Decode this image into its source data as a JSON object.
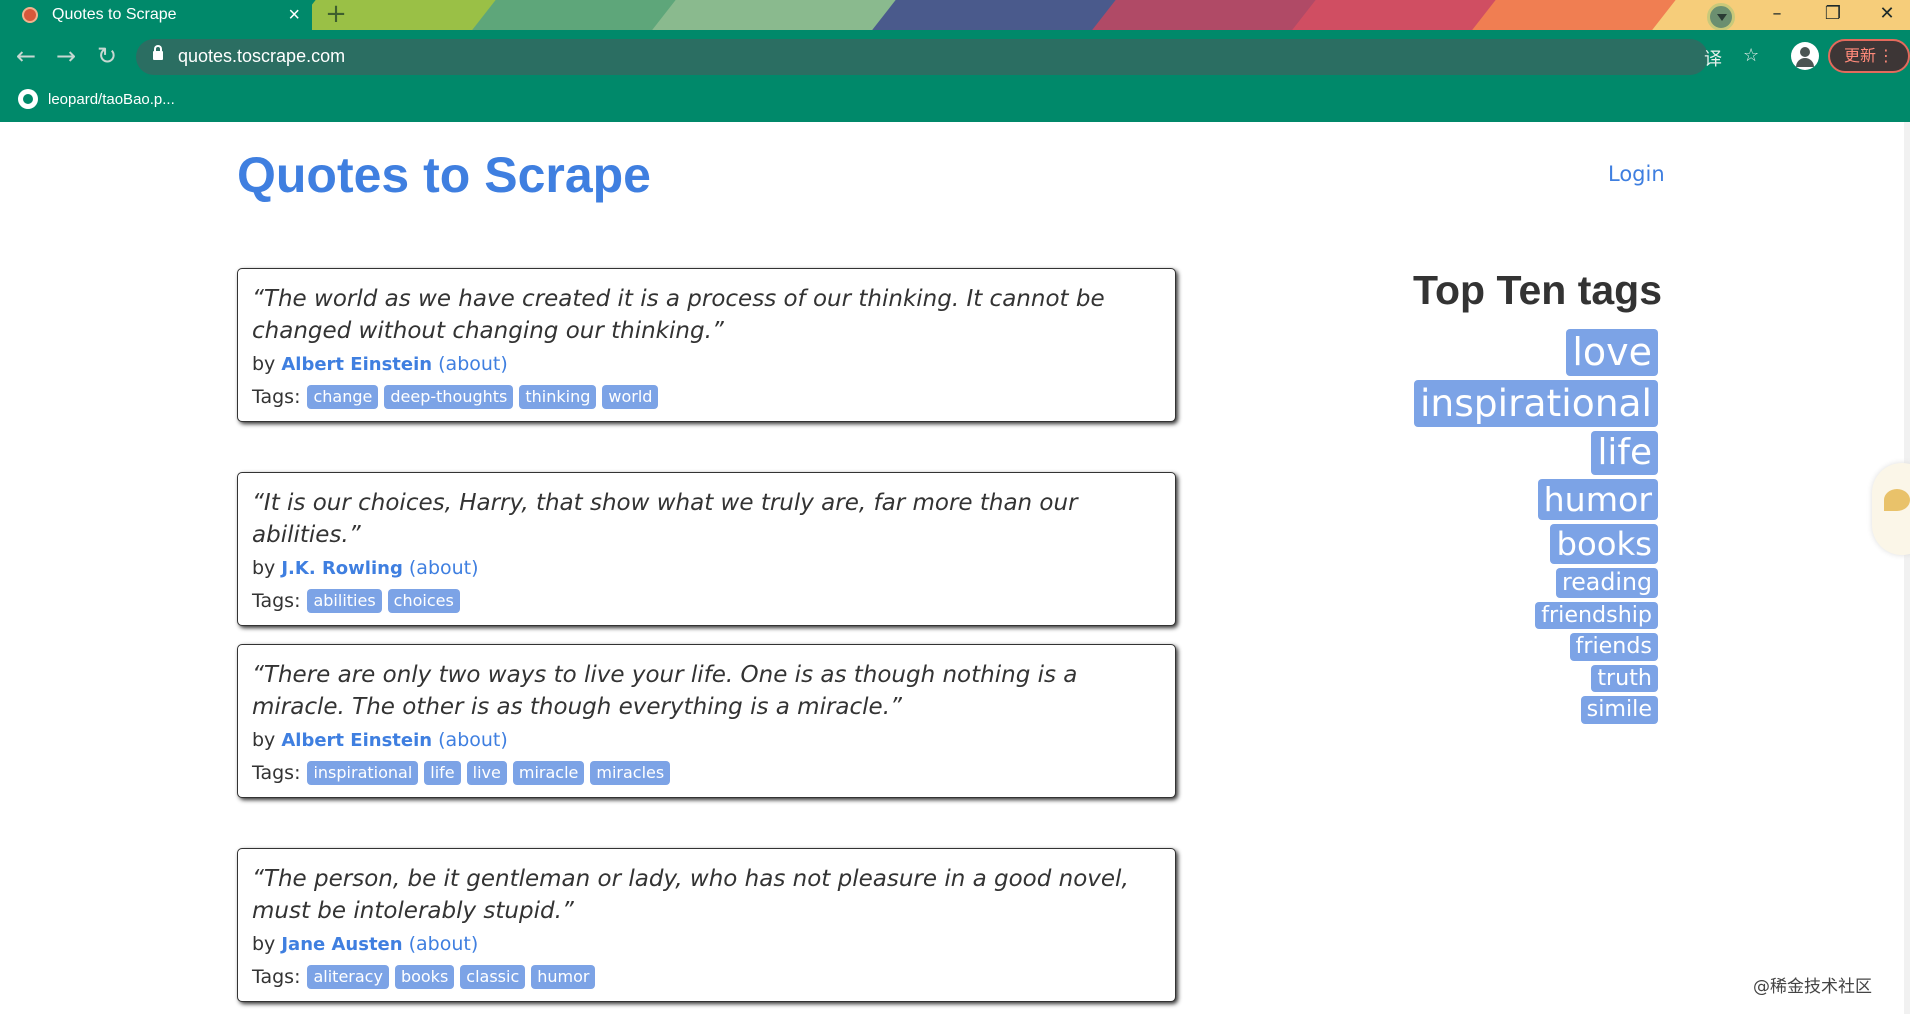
{
  "browser": {
    "tab_title": "Quotes to Scrape",
    "tab_close": "×",
    "new_tab": "+",
    "url": "quotes.toscrape.com",
    "update_label": "更新",
    "bookmark": "leopard/taoBao.p...",
    "icons": [
      "back-icon",
      "forward-icon",
      "reload-icon",
      "lock-icon",
      "translate-icon",
      "star-icon",
      "account-icon",
      "minimize-icon",
      "maximize-icon",
      "close-icon"
    ],
    "accent": "#00896a"
  },
  "site": {
    "title": "Quotes to Scrape",
    "login": "Login",
    "by_word": "by",
    "about_text": "(about)",
    "tags_label": "Tags:"
  },
  "quotes": [
    {
      "text": "“The world as we have created it is a process of our thinking. It cannot be changed without changing our thinking.”",
      "author": "Albert Einstein",
      "tags": [
        "change",
        "deep-thoughts",
        "thinking",
        "world"
      ]
    },
    {
      "text": "“It is our choices, Harry, that show what we truly are, far more than our abilities.”",
      "author": "J.K. Rowling",
      "tags": [
        "abilities",
        "choices"
      ]
    },
    {
      "text": "“There are only two ways to live your life. One is as though nothing is a miracle. The other is as though everything is a miracle.”",
      "author": "Albert Einstein",
      "tags": [
        "inspirational",
        "life",
        "live",
        "miracle",
        "miracles"
      ]
    },
    {
      "text": "“The person, be it gentleman or lady, who has not pleasure in a good novel, must be intolerably stupid.”",
      "author": "Jane Austen",
      "tags": [
        "aliteracy",
        "books",
        "classic",
        "humor"
      ]
    }
  ],
  "top_tags": {
    "heading": "Top Ten tags",
    "items": [
      {
        "label": "love",
        "weight": 1.0
      },
      {
        "label": "inspirational",
        "weight": 0.98
      },
      {
        "label": "life",
        "weight": 0.9
      },
      {
        "label": "humor",
        "weight": 0.78
      },
      {
        "label": "books",
        "weight": 0.74
      },
      {
        "label": "reading",
        "weight": 0.35
      },
      {
        "label": "friendship",
        "weight": 0.28
      },
      {
        "label": "friends",
        "weight": 0.28
      },
      {
        "label": "truth",
        "weight": 0.28
      },
      {
        "label": "simile",
        "weight": 0.28
      }
    ]
  },
  "watermark": "@稀金技术社区",
  "colors": {
    "link": "#3f7fe0",
    "tag": "#7ca3e6",
    "text": "#333333"
  }
}
